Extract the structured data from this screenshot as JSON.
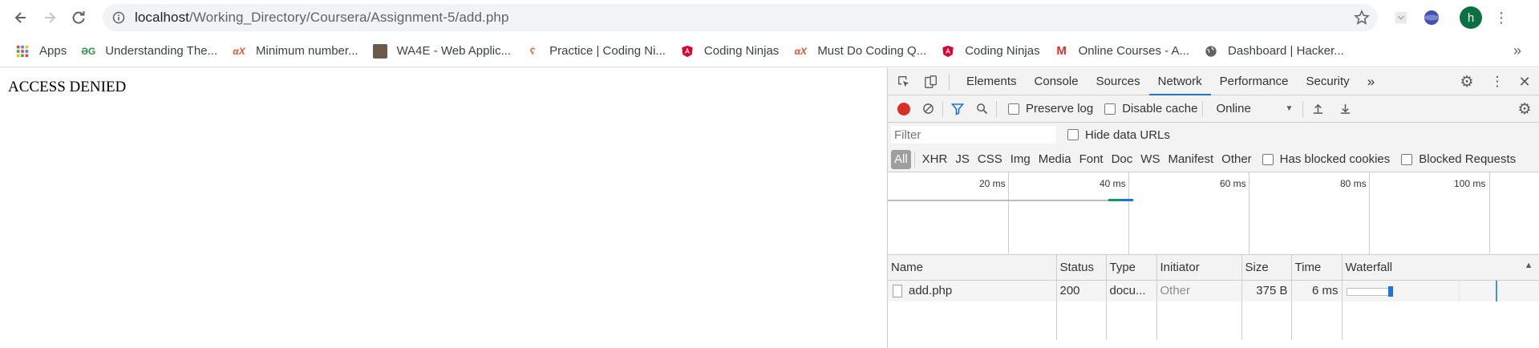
{
  "browser": {
    "url_host": "localhost",
    "url_path": "/Working_Directory/Coursera/Assignment-5/add.php",
    "avatar_letter": "h"
  },
  "bookmarks": [
    {
      "label": "Apps",
      "icon": "apps-grid-icon"
    },
    {
      "label": "Understanding The...",
      "icon": "gfg-icon"
    },
    {
      "label": "Minimum number...",
      "icon": "edx-icon"
    },
    {
      "label": "WA4E - Web Applic...",
      "icon": "wa4e-icon"
    },
    {
      "label": "Practice | Coding Ni...",
      "icon": "coding-ninjas-icon"
    },
    {
      "label": "Coding Ninjas",
      "icon": "angular-icon"
    },
    {
      "label": "Must Do Coding Q...",
      "icon": "edx-icon"
    },
    {
      "label": "Coding Ninjas",
      "icon": "angular-icon"
    },
    {
      "label": "Online Courses - A...",
      "icon": "gmail-icon"
    },
    {
      "label": "Dashboard | Hacker...",
      "icon": "globe-icon"
    }
  ],
  "page": {
    "message": "ACCESS DENIED"
  },
  "devtools": {
    "tabs": [
      "Elements",
      "Console",
      "Sources",
      "Network",
      "Performance",
      "Security"
    ],
    "active_tab": "Network",
    "preserve_log": "Preserve log",
    "disable_cache": "Disable cache",
    "throttling": "Online",
    "filter_placeholder": "Filter",
    "hide_data_urls": "Hide data URLs",
    "types": [
      "All",
      "XHR",
      "JS",
      "CSS",
      "Img",
      "Media",
      "Font",
      "Doc",
      "WS",
      "Manifest",
      "Other"
    ],
    "has_blocked_cookies": "Has blocked cookies",
    "blocked_requests": "Blocked Requests",
    "timeline_ticks": [
      "20 ms",
      "40 ms",
      "60 ms",
      "80 ms",
      "100 ms"
    ],
    "columns": [
      "Name",
      "Status",
      "Type",
      "Initiator",
      "Size",
      "Time",
      "Waterfall"
    ],
    "requests": [
      {
        "name": "add.php",
        "status": "200",
        "type": "docu...",
        "initiator": "Other",
        "size": "375 B",
        "time": "6 ms"
      }
    ]
  }
}
